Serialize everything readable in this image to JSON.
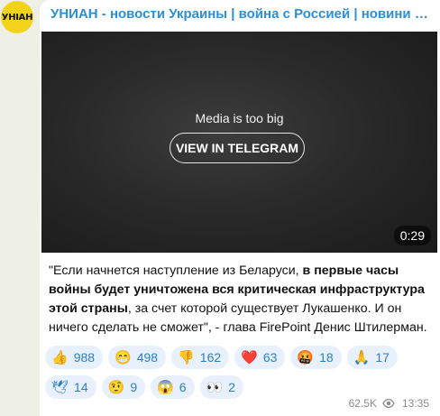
{
  "channel": {
    "avatar_text": "УНІАН",
    "title": "УНИАН - новости Украины | война с Россией | новини України | война з Росією"
  },
  "media": {
    "message": "Media is too big",
    "button_label": "VIEW IN TELEGRAM",
    "duration": "0:29"
  },
  "post": {
    "text_part1": "\"Если начнется наступление из Беларуси, ",
    "text_bold": "в первые часы войны будет уничтожена вся критическая инфраструктура этой страны",
    "text_part2": ", за счет которой существует Лукашенко. И он ничего сделать не сможет\", - глава FirePoint Денис Штилерман."
  },
  "reactions": [
    {
      "emoji": "👍",
      "icon": "thumbs-up-icon",
      "count": "988"
    },
    {
      "emoji": "😁",
      "icon": "grin-icon",
      "count": "498"
    },
    {
      "emoji": "👎",
      "icon": "thumbs-down-icon",
      "count": "162"
    },
    {
      "emoji": "❤️",
      "icon": "heart-icon",
      "count": "63"
    },
    {
      "emoji": "🤬",
      "icon": "angry-face-icon",
      "count": "18"
    },
    {
      "emoji": "🙏",
      "icon": "pray-icon",
      "count": "17"
    },
    {
      "emoji": "🕊",
      "icon": "dove-icon",
      "count": "14"
    },
    {
      "emoji": "🤨",
      "icon": "raised-eyebrow-icon",
      "count": "9"
    },
    {
      "emoji": "😱",
      "icon": "scream-icon",
      "count": "6"
    },
    {
      "emoji": "👀",
      "icon": "eyes-icon",
      "count": "2"
    }
  ],
  "meta": {
    "views": "62.5K",
    "time": "13:35"
  }
}
